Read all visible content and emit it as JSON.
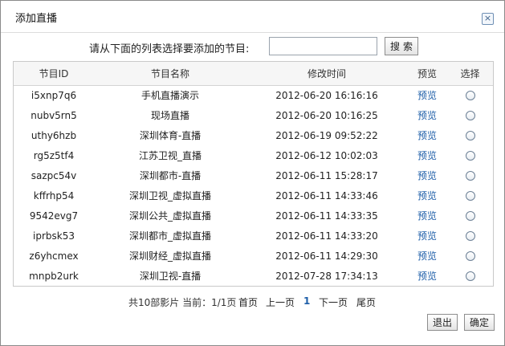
{
  "dialog": {
    "title": "添加直播",
    "close_label": "×"
  },
  "search": {
    "label": "请从下面的列表选择要添加的节目:",
    "value": "",
    "placeholder": "",
    "button_label": "搜索"
  },
  "table": {
    "headers": {
      "id": "节目ID",
      "name": "节目名称",
      "time": "修改时间",
      "preview": "预览",
      "select": "选择"
    },
    "rows": [
      {
        "id": "i5xnp7q6",
        "name": "手机直播演示",
        "time": "2012-06-20 16:16:16",
        "preview": "预览"
      },
      {
        "id": "nubv5rn5",
        "name": "现场直播",
        "time": "2012-06-20 10:16:25",
        "preview": "预览"
      },
      {
        "id": "uthy6hzb",
        "name": "深圳体育-直播",
        "time": "2012-06-19 09:52:22",
        "preview": "预览"
      },
      {
        "id": "rg5z5tf4",
        "name": "江苏卫视_直播",
        "time": "2012-06-12 10:02:03",
        "preview": "预览"
      },
      {
        "id": "sazpc54v",
        "name": "深圳都市-直播",
        "time": "2012-06-11 15:28:17",
        "preview": "预览"
      },
      {
        "id": "kffrhp54",
        "name": "深圳卫视_虚拟直播",
        "time": "2012-06-11 14:33:46",
        "preview": "预览"
      },
      {
        "id": "9542evg7",
        "name": "深圳公共_虚拟直播",
        "time": "2012-06-11 14:33:35",
        "preview": "预览"
      },
      {
        "id": "iprbsk53",
        "name": "深圳都市_虚拟直播",
        "time": "2012-06-11 14:33:20",
        "preview": "预览"
      },
      {
        "id": "z6yhcmex",
        "name": "深圳财经_虚拟直播",
        "time": "2012-06-11 14:29:30",
        "preview": "预览"
      },
      {
        "id": "mnpb2urk",
        "name": "深圳卫视-直播",
        "time": "2012-07-28 17:34:13",
        "preview": "预览"
      }
    ]
  },
  "pager": {
    "summary": "共10部影片 当前：1/1页",
    "first": "首页",
    "prev": "上一页",
    "current": "1",
    "next": "下一页",
    "last": "尾页"
  },
  "footer": {
    "exit_label": "退出",
    "ok_label": "确定"
  }
}
